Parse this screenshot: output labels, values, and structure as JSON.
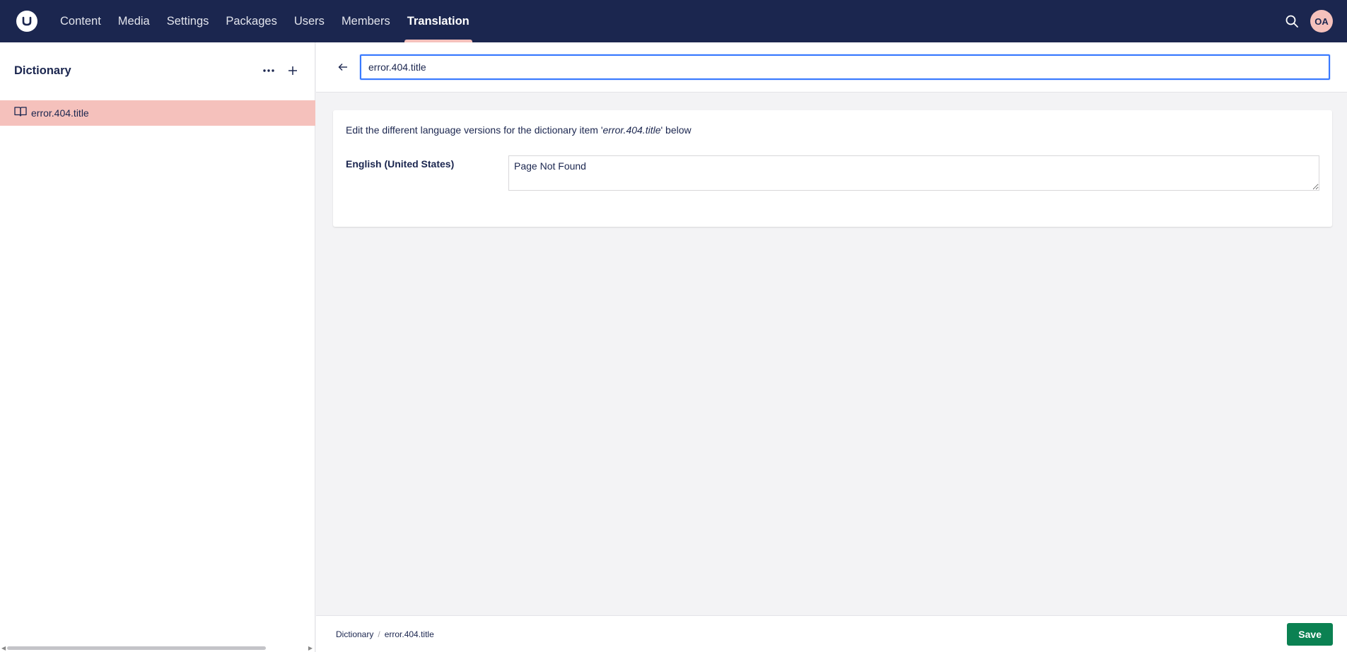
{
  "topbar": {
    "logo_alt": "Umbraco",
    "nav": [
      {
        "label": "Content"
      },
      {
        "label": "Media"
      },
      {
        "label": "Settings"
      },
      {
        "label": "Packages"
      },
      {
        "label": "Users"
      },
      {
        "label": "Members"
      },
      {
        "label": "Translation",
        "active": true
      }
    ],
    "avatar_initials": "OA",
    "colors": {
      "bar": "#1b264f",
      "accent": "#f5c1bc"
    }
  },
  "sidebar": {
    "title": "Dictionary",
    "more_icon": "ellipsis-icon",
    "add_icon": "plus-icon",
    "items": [
      {
        "label": "error.404.title",
        "icon": "book-icon",
        "selected": true
      }
    ]
  },
  "editor": {
    "name_value": "error.404.title",
    "description_prefix": "Edit the different language versions for the dictionary item '",
    "description_item": "error.404.title",
    "description_suffix": "' below",
    "languages": [
      {
        "label": "English (United States)",
        "value": "Page Not Found"
      }
    ]
  },
  "footer": {
    "breadcrumb": [
      "Dictionary",
      "error.404.title"
    ],
    "save_label": "Save",
    "save_color": "#0b8152"
  }
}
